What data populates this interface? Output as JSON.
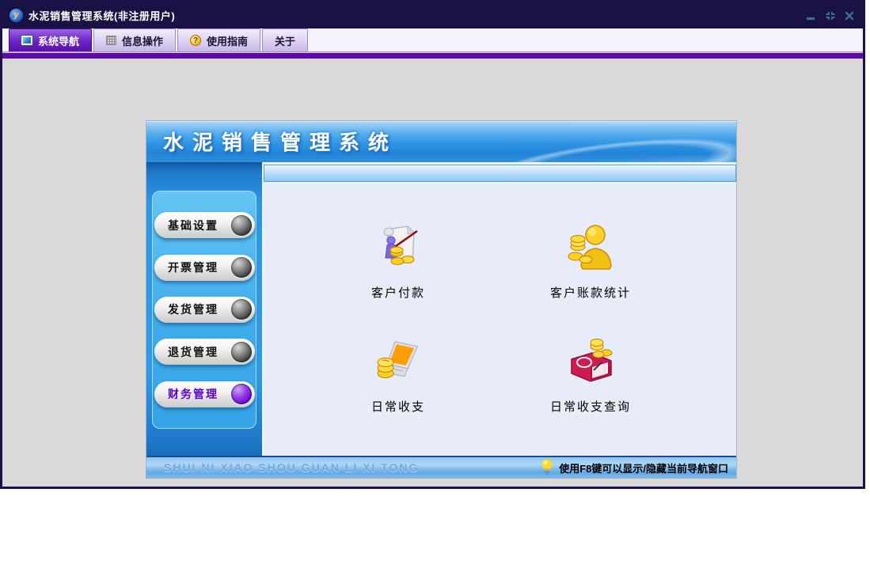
{
  "window": {
    "title": "水泥销售管理系统(非注册用户)",
    "app_icon_letter": "y"
  },
  "tabs": [
    {
      "label": "系统导航",
      "icon": "monitor",
      "active": true
    },
    {
      "label": "信息操作",
      "icon": "grid",
      "active": false
    },
    {
      "label": "使用指南",
      "icon": "help",
      "active": false
    },
    {
      "label": "关于",
      "icon": "none",
      "active": false
    }
  ],
  "panel": {
    "banner_title": "水泥销售管理系统",
    "sidebar_buttons": [
      {
        "label": "基础设置",
        "active": false
      },
      {
        "label": "开票管理",
        "active": false
      },
      {
        "label": "发货管理",
        "active": false
      },
      {
        "label": "退货管理",
        "active": false
      },
      {
        "label": "财务管理",
        "active": true
      }
    ],
    "items": [
      {
        "label": "客户付款",
        "icon": "customer-payment"
      },
      {
        "label": "客户账款统计",
        "icon": "customer-account-stats"
      },
      {
        "label": "日常收支",
        "icon": "daily-expense"
      },
      {
        "label": "日常收支查询",
        "icon": "daily-expense-query"
      }
    ],
    "statusbar": {
      "left": "SHUI NI XIAO SHOU GUAN LI XI TONG",
      "right": "使用F8键可以显示/隐藏当前导航窗口"
    }
  },
  "colors": {
    "titlebar": "#181245",
    "accent_purple": "#5c0aa8",
    "active_tab": "#6d22c6",
    "sidebar_blue": "#2e9ae6",
    "active_button_purple": "#6a0ed0",
    "panel_banner_blue": "#2f93e2",
    "content_bg": "#e7ecf8"
  }
}
